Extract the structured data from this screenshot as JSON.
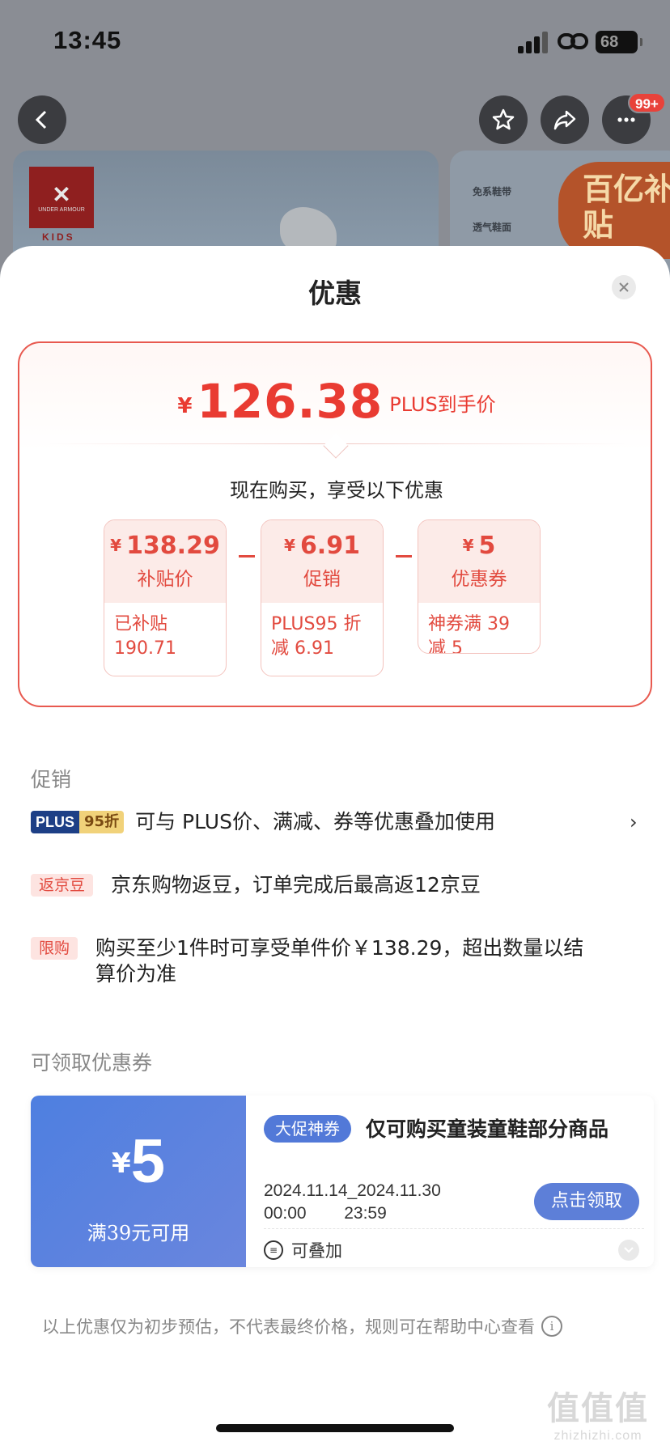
{
  "status_bar": {
    "time": "13:45",
    "battery": "68"
  },
  "header": {
    "cart_badge": "99+"
  },
  "banner": {
    "brand": "UNDER ARMOUR",
    "kids": "KIDS",
    "feature_1": "免系鞋带",
    "feature_2": "透气鞋面",
    "subsidy": "百亿补贴"
  },
  "sheet": {
    "title": "优惠"
  },
  "price": {
    "currency": "¥",
    "amount": "126.38",
    "label": "PLUS到手价",
    "buy_now": "现在购买，享受以下优惠"
  },
  "breakdown": [
    {
      "currency": "¥",
      "value": "138.29",
      "label": "补贴价",
      "detail": "已补贴\n190.71"
    },
    {
      "currency": "¥",
      "value": "6.91",
      "label": "促销",
      "detail": "PLUS95 折\n减 6.91"
    },
    {
      "currency": "¥",
      "value": "5",
      "label": "优惠券",
      "detail": "神券满 39 减 5"
    }
  ],
  "promotions": {
    "section_label": "促销",
    "items": [
      {
        "tag_a": "PLUS",
        "tag_b": "95折",
        "text": "可与 PLUS价、满减、券等优惠叠加使用"
      },
      {
        "tag": "返京豆",
        "text": "京东购物返豆，订单完成后最高返12京豆"
      },
      {
        "tag": "限购",
        "text": "购买至少1件时可享受单件价￥138.29，超出数量以结算价为准"
      }
    ]
  },
  "coupons": {
    "section_label": "可领取优惠券",
    "items": [
      {
        "currency": "¥",
        "value": "5",
        "condition": "满39元可用",
        "tag": "大促神券",
        "title": "仅可购买童装童鞋部分商品",
        "date_line_1": "2024.11.14_2024.11.30",
        "date_line_2": "00:00        23:59",
        "button": "点击领取",
        "stackable": "可叠加"
      }
    ]
  },
  "disclaimer": "以上优惠仅为初步预估，不代表最终价格，规则可在帮助中心查看",
  "watermark": {
    "logo": "值值值",
    "site": "zhizhizhi.com"
  },
  "colors": {
    "accent": "#e93b32",
    "coupon_blue": "#5279d8"
  }
}
